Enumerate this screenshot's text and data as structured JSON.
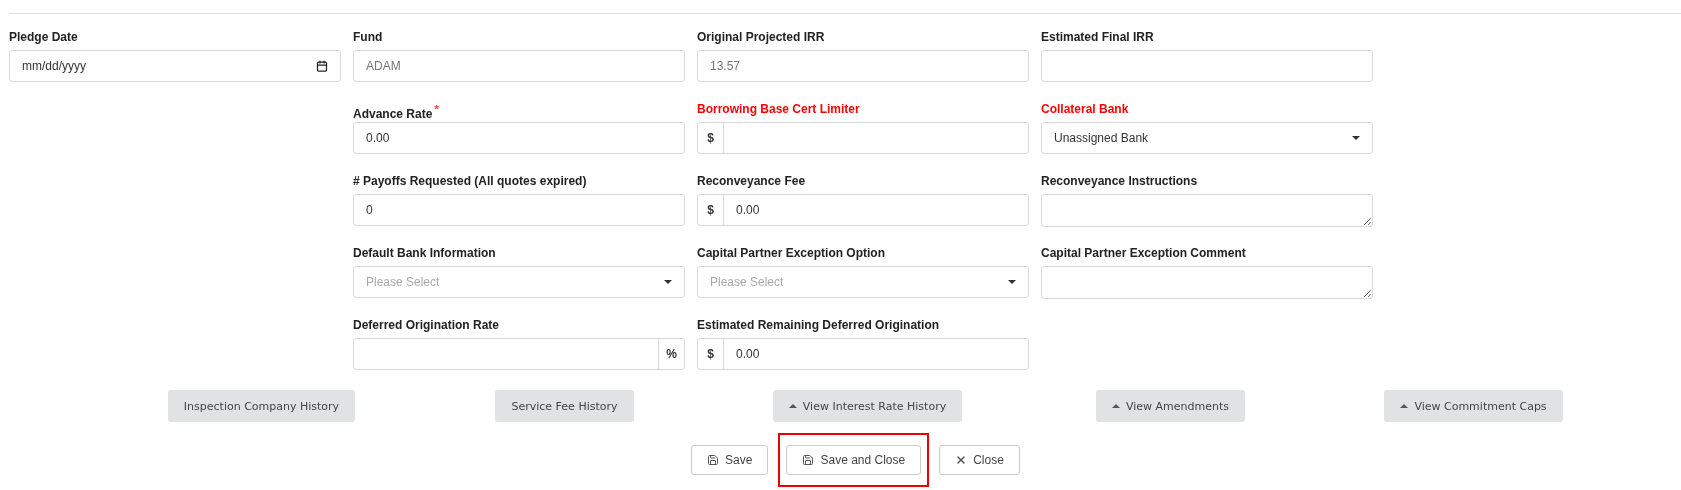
{
  "pledge": {
    "label": "Pledge Date",
    "kind": "date",
    "placeholder": "mm/dd/yyyy"
  },
  "rows": [
    [
      {
        "label": "Fund",
        "kind": "text",
        "value": "ADAM",
        "readonly": true
      },
      {
        "label": "Original Projected IRR",
        "kind": "text",
        "value": "13.57",
        "readonly": true
      },
      {
        "label": "Estimated Final IRR",
        "kind": "text"
      }
    ],
    [
      {
        "label": "Advance Rate",
        "required_mark": "*",
        "kind": "text",
        "value": "0.00"
      },
      {
        "label": "Borrowing Base Cert Limiter",
        "invalid": true,
        "kind": "text",
        "prefix": "$"
      },
      {
        "label": "Collateral Bank",
        "invalid": true,
        "kind": "select",
        "value": "Unassigned Bank"
      }
    ],
    [
      {
        "label": "# Payoffs Requested (All quotes expired)",
        "kind": "text",
        "value": "0"
      },
      {
        "label": "Reconveyance Fee",
        "kind": "text",
        "prefix": "$",
        "value": "0.00"
      },
      {
        "label": "Reconveyance Instructions",
        "kind": "textarea"
      }
    ],
    [
      {
        "label": "Default Bank Information",
        "kind": "select",
        "placeholder": "Please Select"
      },
      {
        "label": "Capital Partner Exception Option",
        "kind": "select",
        "placeholder": "Please Select"
      },
      {
        "label": "Capital Partner Exception Comment",
        "kind": "textarea"
      }
    ],
    [
      {
        "label": "Deferred Origination Rate",
        "kind": "text",
        "suffix": "%"
      },
      {
        "label": "Estimated Remaining Deferred Origination",
        "kind": "text",
        "prefix": "$",
        "value": "0.00"
      }
    ]
  ],
  "history_buttons": [
    {
      "label": "Inspection Company History",
      "expander": false
    },
    {
      "label": "Service Fee History",
      "expander": false
    },
    {
      "label": "View Interest Rate History",
      "expander": true
    },
    {
      "label": "View Amendments",
      "expander": true
    },
    {
      "label": "View Commitment Caps",
      "expander": true
    }
  ],
  "actions": [
    {
      "label": "Save",
      "kind": "save",
      "highlighted": false
    },
    {
      "label": "Save and Close",
      "kind": "save",
      "highlighted": true
    },
    {
      "label": "Close",
      "kind": "close",
      "highlighted": false
    }
  ]
}
